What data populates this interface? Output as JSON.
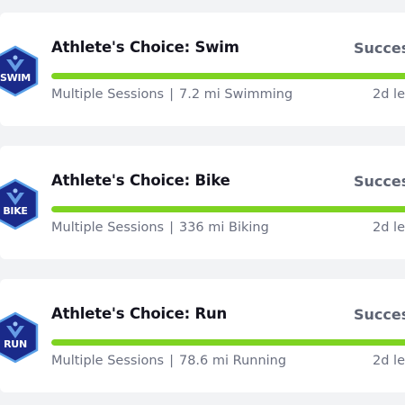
{
  "colors": {
    "progress_fill": "#7ed321",
    "progress_track": "#e2e5ea",
    "badge_bg": "#1a2a8a",
    "badge_border": "#5aa0e8",
    "card_bg": "#ffffff",
    "page_bg": "#f2f3f5"
  },
  "challenges": [
    {
      "badge_icon": "swim-badge-icon",
      "badge_label": "SWIM",
      "title": "Athlete's Choice: Swim",
      "status": "Succes",
      "progress": 1.0,
      "sessions": "Multiple Sessions",
      "separator": "|",
      "distance": "7.2 mi Swimming",
      "time_left": "2d le"
    },
    {
      "badge_icon": "bike-badge-icon",
      "badge_label": "BIKE",
      "title": "Athlete's Choice: Bike",
      "status": "Succes",
      "progress": 1.0,
      "sessions": "Multiple Sessions",
      "separator": "|",
      "distance": "336 mi Biking",
      "time_left": "2d le"
    },
    {
      "badge_icon": "run-badge-icon",
      "badge_label": "RUN",
      "title": "Athlete's Choice: Run",
      "status": "Succes",
      "progress": 1.0,
      "sessions": "Multiple Sessions",
      "separator": "|",
      "distance": "78.6 mi Running",
      "time_left": "2d le"
    }
  ]
}
